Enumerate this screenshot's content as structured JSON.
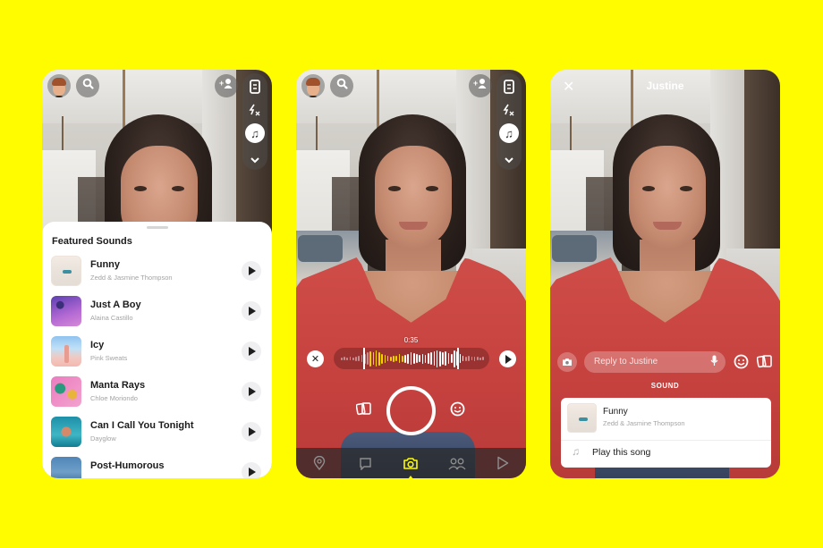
{
  "brand": {
    "background": "#FFFC00",
    "accent": "#FFFC00"
  },
  "icons": {
    "search": "⌕",
    "add_friend": "+👤",
    "flip_camera": "⟳",
    "flash": "ϟ×",
    "music": "♫",
    "chevron_down": "⌄",
    "play": "▶",
    "close": "✕",
    "memories": "❐",
    "lens": "☺",
    "camera": "◉",
    "mic": "🎙",
    "note": "♫",
    "nav_map": "⌖",
    "nav_chat": "▭",
    "nav_camera": "◎",
    "nav_stories": "⚇",
    "nav_spotlight": "▷"
  },
  "screen1": {
    "sheet_title": "Featured Sounds",
    "tracks": [
      {
        "name": "Funny",
        "artist": "Zedd & Jasmine Thompson",
        "art": "funny"
      },
      {
        "name": "Just A Boy",
        "artist": "Alaina Castillo",
        "art": "boy"
      },
      {
        "name": "Icy",
        "artist": "Pink Sweats",
        "art": "icy"
      },
      {
        "name": "Manta Rays",
        "artist": "Chloe Moriondo",
        "art": "manta"
      },
      {
        "name": "Can I Call You Tonight",
        "artist": "Dayglow",
        "art": "call"
      },
      {
        "name": "Post-Humorous",
        "artist": "",
        "art": "post"
      }
    ]
  },
  "screen2": {
    "timecode": "0:35",
    "waveform": {
      "selection_start": 0.2,
      "selection_end": 0.84,
      "played_fraction": 0.42,
      "levels": [
        0.15,
        0.2,
        0.15,
        0.2,
        0.15,
        0.25,
        0.3,
        0.4,
        0.55,
        0.7,
        0.85,
        0.7,
        0.9,
        0.75,
        0.55,
        0.45,
        0.3,
        0.25,
        0.35,
        0.3,
        0.5,
        0.35,
        0.45,
        0.55,
        0.7,
        0.6,
        0.5,
        0.4,
        0.55,
        0.45,
        0.6,
        0.7,
        0.8,
        0.95,
        0.85,
        0.7,
        0.8,
        0.6,
        0.5,
        0.95,
        0.8,
        0.5,
        0.3,
        0.25,
        0.3,
        0.2,
        0.25,
        0.2,
        0.15,
        0.2
      ],
      "played_color": "#F5D200",
      "unplayed_color": "#FFFFFF"
    },
    "nav": [
      "map",
      "chat",
      "camera",
      "stories",
      "spotlight"
    ],
    "active_nav": "camera"
  },
  "screen3": {
    "title": "Justine",
    "reply_placeholder": "Reply to Justine",
    "sound_label": "SOUND",
    "sound_card": {
      "name": "Funny",
      "artist": "Zedd & Jasmine Thompson",
      "action": "Play this song"
    }
  }
}
